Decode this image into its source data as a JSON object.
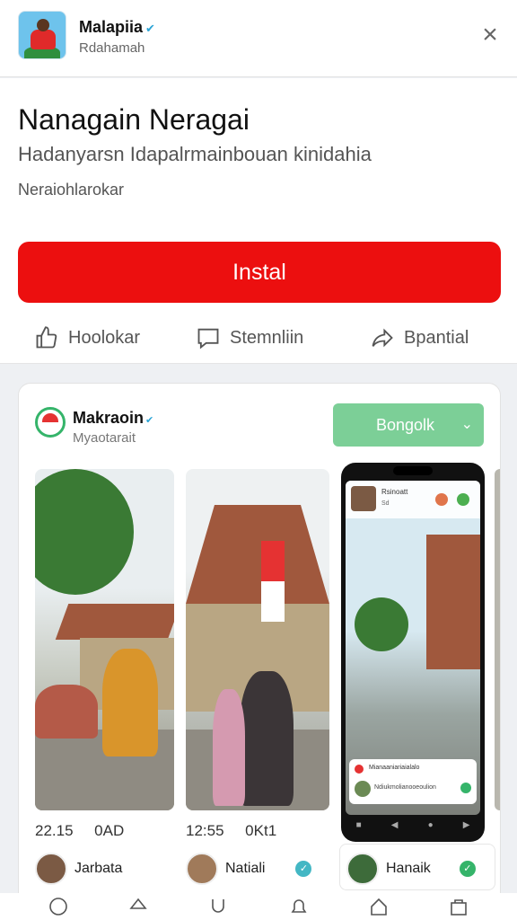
{
  "header": {
    "app_name": "Malapiia",
    "verified_mark": "✔",
    "developer": "Rdahamah",
    "close_label": "×"
  },
  "info": {
    "headline": "Nanagain Neragai",
    "description": "Hadanyarsn Idapalrmainbouan kinidahia",
    "subline": "Neraiohlarokar",
    "install_label": "Instal",
    "actions": [
      {
        "label": "Hoolokar",
        "icon": "thumbs-up-icon"
      },
      {
        "label": "Stemnliin",
        "icon": "comment-icon"
      },
      {
        "label": "Bpantial",
        "icon": "share-icon"
      }
    ]
  },
  "card": {
    "name": "Makraoin",
    "verified_mark": "✔",
    "subtitle": "Myaotarait",
    "button_label": "Bongolk",
    "button_chevron": "⌄",
    "phone": {
      "header_line1": "Rsinoatt",
      "header_line2": "Sd",
      "notif_line1": "Mianaaniariaialalo",
      "notif_line2": "Ndiukmolianooeoulion"
    },
    "photos": [
      {
        "time": "22.15",
        "label": "0AD"
      },
      {
        "time": "12:55",
        "label": "0Kt1"
      }
    ],
    "users": [
      {
        "name": "Jarbata"
      },
      {
        "name": "Natiali"
      },
      {
        "name": "Hanaik"
      }
    ]
  },
  "bottom_nav": [
    "chat-icon",
    "tag-icon",
    "magnet-icon",
    "bell-icon",
    "home-icon",
    "bag-icon"
  ],
  "colors": {
    "install": "#ec0f0f",
    "card_button": "#7ccf97",
    "verified": "#2ba4d6"
  }
}
